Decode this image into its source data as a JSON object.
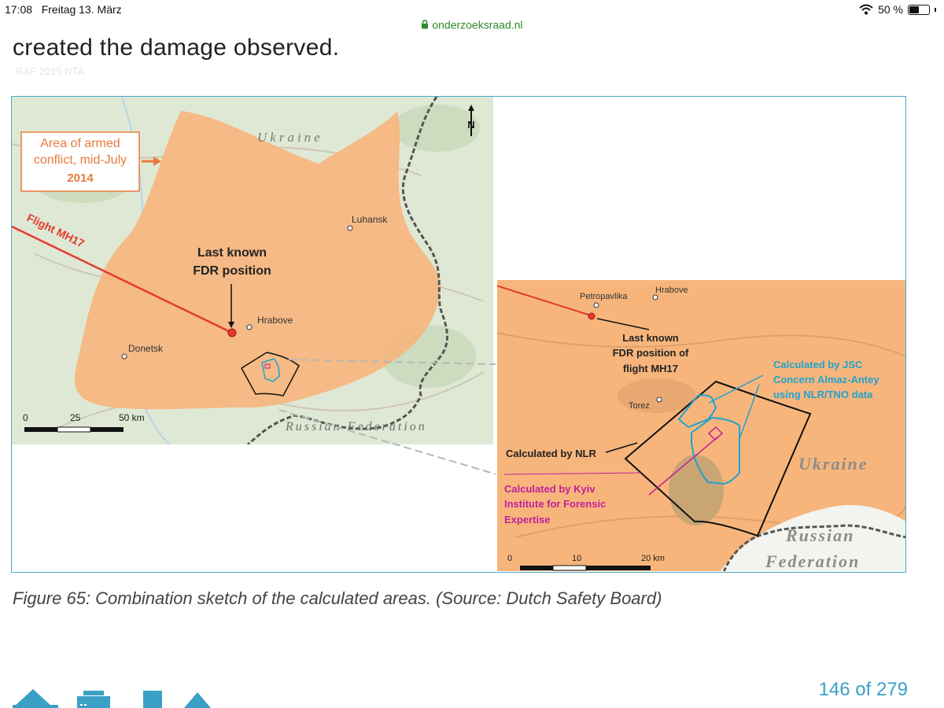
{
  "status_bar": {
    "time": "17:08",
    "date": "Freitag 13. März",
    "battery_text": "50 %",
    "battery_level": 0.5
  },
  "browser": {
    "url": "onderzoeksraad.nl"
  },
  "document": {
    "heading_text": "created the damage observed.",
    "faint_text": "RAF 2015 NTA",
    "figure_caption": "Figure 65: Combination sketch of the calculated areas. (Source: Dutch Safety Board)",
    "page_counter": "146 of 279"
  },
  "map_left": {
    "legend_line1": "Area of armed",
    "legend_line2": "conflict, mid-July",
    "legend_line3": "2014",
    "country_ukraine": "Ukraine",
    "country_russia": "Russian Federation",
    "flight_label": "Flight MH17",
    "fdr_line1": "Last known",
    "fdr_line2": "FDR position",
    "north": "N",
    "city_luhansk": "Luhansk",
    "city_hrabove": "Hrabove",
    "city_donetsk": "Donetsk",
    "scale_0": "0",
    "scale_25": "25",
    "scale_50": "50 km"
  },
  "map_inset": {
    "city_petropavlika": "Petropavlika",
    "city_hrabove": "Hrabove",
    "city_torez": "Torez",
    "fdr_line1": "Last known",
    "fdr_line2": "FDR position of",
    "fdr_line3": "flight MH17",
    "jsc_line1": "Calculated by JSC",
    "jsc_line2": "Concern Almaz-Antey",
    "jsc_line3": "using NLR/TNO data",
    "nlr_label": "Calculated by NLR",
    "kyiv_line1": "Calculated by Kyiv",
    "kyiv_line2": "Institute for Forensic",
    "kyiv_line3": "Expertise",
    "country_ukraine": "Ukraine",
    "country_russian": "Russian",
    "country_federation": "Federation",
    "scale_0": "0",
    "scale_10": "10",
    "scale_20": "20 km"
  },
  "colors": {
    "conflict_area": "#f7b57c",
    "map_base": "#dfe8d4",
    "flight_path": "#e23b2e",
    "legend_orange": "#ea7a3a",
    "nlr_area": "#111111",
    "jsc_area": "#21a3cf",
    "kyiv_area": "#c0209a",
    "accent": "#3aa0c6"
  },
  "icons": [
    "wifi-icon",
    "battery-icon",
    "lock-icon",
    "pages-icon",
    "print-icon",
    "stop-icon",
    "up-icon"
  ]
}
